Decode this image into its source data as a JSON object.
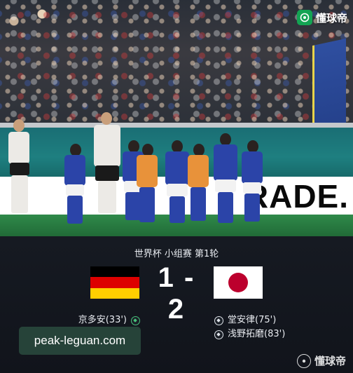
{
  "brand": {
    "name": "懂球帝"
  },
  "photo": {
    "adboard_text": "RADE."
  },
  "match": {
    "stage": "世界杯 小组赛 第1轮",
    "home_score": "1",
    "away_score": "2",
    "score_separator": "-"
  },
  "home_team": {
    "flag_colors": [
      "#000000",
      "#dd0000",
      "#ffce00"
    ],
    "scorers": [
      {
        "label": "京多安(33')",
        "icon": "football-icon"
      }
    ]
  },
  "away_team": {
    "flag_colors": [
      "#ffffff",
      "#bc002d"
    ],
    "scorers": [
      {
        "label": "堂安律(75')",
        "icon": "football-icon"
      },
      {
        "label": "浅野拓磨(83')",
        "icon": "football-icon"
      }
    ]
  },
  "watermark": {
    "text": "peak-leguan.com"
  }
}
